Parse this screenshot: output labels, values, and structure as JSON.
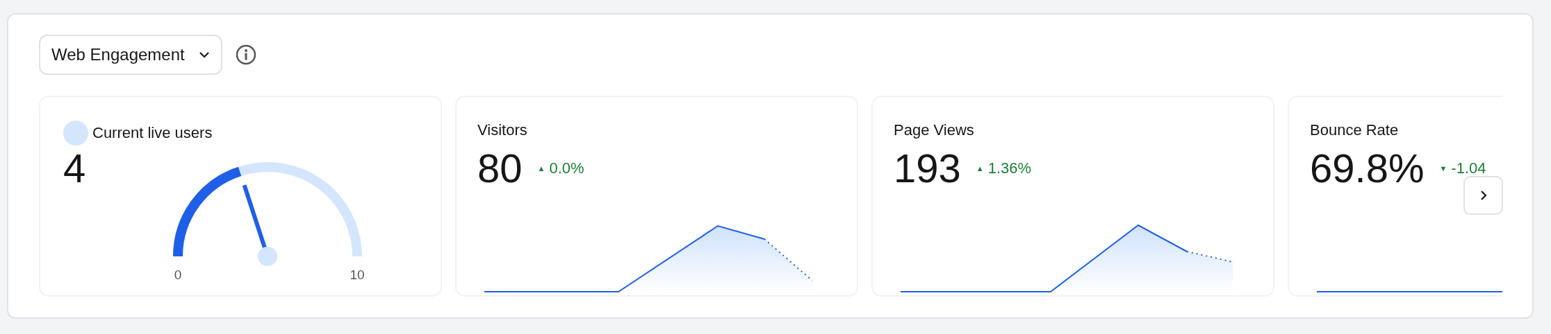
{
  "selector": {
    "label": "Web Engagement"
  },
  "cards": [
    {
      "kind": "gauge",
      "title": "Current live users",
      "value": "4",
      "min_label": "0",
      "max_label": "10"
    },
    {
      "kind": "metric",
      "title": "Visitors",
      "value": "80",
      "trend_icon": "▲",
      "change": "0.0%"
    },
    {
      "kind": "metric",
      "title": "Page Views",
      "value": "193",
      "trend_icon": "▲",
      "change": "1.36%"
    },
    {
      "kind": "metric",
      "title": "Bounce Rate",
      "value": "69.8%",
      "trend_icon": "▼",
      "change": "-1.04"
    }
  ]
}
